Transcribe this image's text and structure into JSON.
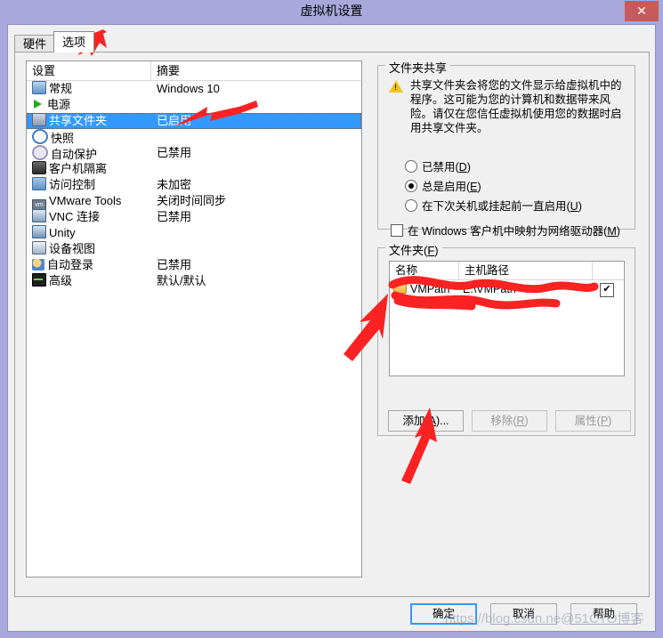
{
  "window": {
    "title": "虚拟机设置",
    "close_label": "✕"
  },
  "tabs": [
    {
      "label": "硬件",
      "active": false
    },
    {
      "label": "选项",
      "active": true
    }
  ],
  "settings_list": {
    "columns": [
      "设置",
      "摘要"
    ],
    "rows": [
      {
        "icon": "monitor-icon",
        "name": "常规",
        "summary": "Windows 10",
        "selected": false
      },
      {
        "icon": "power-play-icon",
        "name": "电源",
        "summary": "",
        "selected": false
      },
      {
        "icon": "shared-folder-icon",
        "name": "共享文件夹",
        "summary": "已启用",
        "selected": true
      },
      {
        "icon": "snapshot-clock-icon",
        "name": "快照",
        "summary": "",
        "selected": false
      },
      {
        "icon": "autoprotect-icon",
        "name": "自动保护",
        "summary": "已禁用",
        "selected": false
      },
      {
        "icon": "lock-icon",
        "name": "客户机隔离",
        "summary": "",
        "selected": false
      },
      {
        "icon": "access-control-icon",
        "name": "访问控制",
        "summary": "未加密",
        "selected": false
      },
      {
        "icon": "vmware-tools-icon",
        "name": "VMware Tools",
        "summary": "关闭时间同步",
        "selected": false
      },
      {
        "icon": "vnc-icon",
        "name": "VNC 连接",
        "summary": "已禁用",
        "selected": false
      },
      {
        "icon": "unity-icon",
        "name": "Unity",
        "summary": "",
        "selected": false
      },
      {
        "icon": "device-view-icon",
        "name": "设备视图",
        "summary": "",
        "selected": false
      },
      {
        "icon": "auto-login-icon",
        "name": "自动登录",
        "summary": "已禁用",
        "selected": false
      },
      {
        "icon": "advanced-icon",
        "name": "高级",
        "summary": "默认/默认",
        "selected": false
      }
    ]
  },
  "sharing": {
    "group_title": "文件夹共享",
    "warning": "共享文件夹会将您的文件显示给虚拟机中的程序。这可能为您的计算机和数据带来风险。请仅在您信任虚拟机使用您的数据时启用共享文件夹。",
    "options": [
      {
        "label": "已禁用(",
        "accel": "D",
        "label_end": ")",
        "checked": false
      },
      {
        "label": "总是启用(",
        "accel": "E",
        "label_end": ")",
        "checked": true
      },
      {
        "label": "在下次关机或挂起前一直启用(",
        "accel": "U",
        "label_end": ")",
        "checked": false
      }
    ],
    "map_drive": {
      "label": "在 Windows 客户机中映射为网络驱动器(",
      "accel": "M",
      "label_end": ")",
      "checked": false
    }
  },
  "folders": {
    "group_title_prefix": "文件夹(",
    "group_title_accel": "F",
    "group_title_suffix": ")",
    "columns": [
      "名称",
      "主机路径",
      ""
    ],
    "rows": [
      {
        "name": "VMPath",
        "path": "E:\\VMPath",
        "enabled": true
      }
    ],
    "buttons": [
      {
        "label": "添加(",
        "accel": "A",
        "label_end": ")...",
        "enabled": true
      },
      {
        "label": "移除(",
        "accel": "R",
        "label_end": ")",
        "enabled": false
      },
      {
        "label": "属性(",
        "accel": "P",
        "label_end": ")",
        "enabled": false
      }
    ]
  },
  "footer": {
    "ok": "确定",
    "cancel": "取消",
    "help": "帮助"
  },
  "watermark": "https://blog.csdn.ne@51CTO博客",
  "colors": {
    "titlebar": "#a8a8dc",
    "close": "#c75b5b",
    "selection": "#3399ff",
    "dialog": "#f0f0f0",
    "annotation": "#fa2222"
  }
}
